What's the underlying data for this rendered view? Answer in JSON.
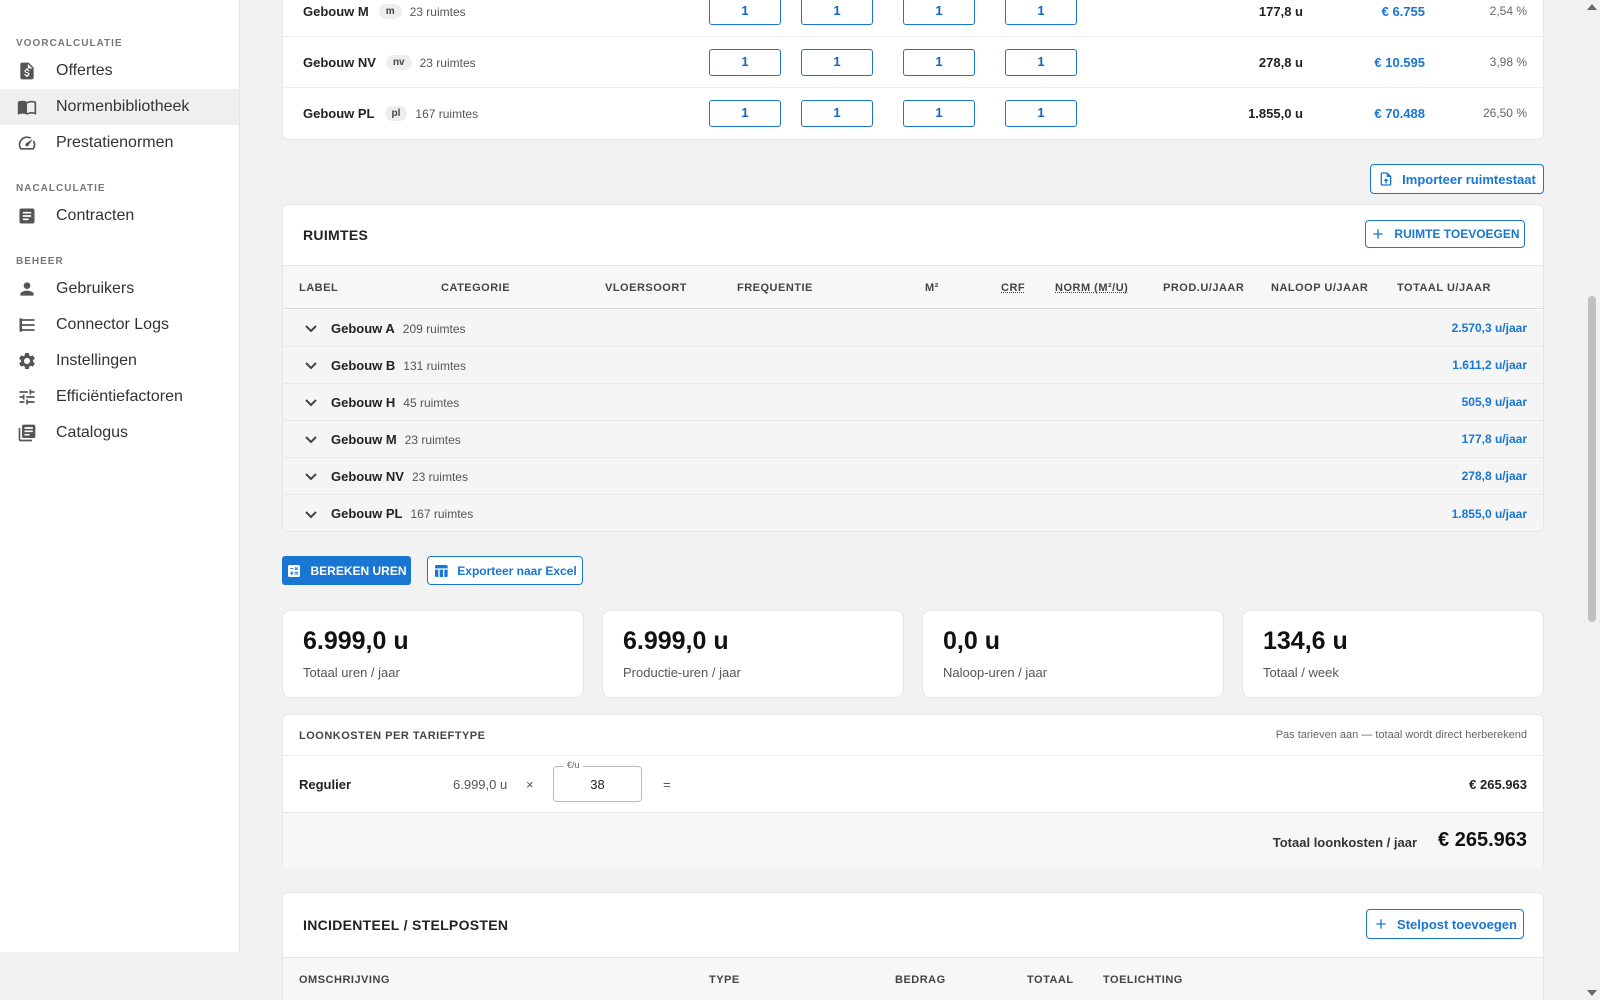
{
  "sidebar": {
    "sections": [
      {
        "title": "VOORCALCULATIE",
        "items": [
          {
            "label": "Offertes",
            "icon": "invoice-icon"
          },
          {
            "label": "Normenbibliotheek",
            "icon": "book-icon"
          },
          {
            "label": "Prestatienormen",
            "icon": "speedometer-icon"
          }
        ]
      },
      {
        "title": "NACALCULATIE",
        "items": [
          {
            "label": "Contracten",
            "icon": "document-icon"
          }
        ]
      },
      {
        "title": "BEHEER",
        "items": [
          {
            "label": "Gebruikers",
            "icon": "person-icon"
          },
          {
            "label": "Connector Logs",
            "icon": "list-icon"
          },
          {
            "label": "Instellingen",
            "icon": "gear-icon"
          },
          {
            "label": "Efficiëntiefactoren",
            "icon": "sliders-icon"
          },
          {
            "label": "Catalogus",
            "icon": "library-icon"
          }
        ]
      }
    ]
  },
  "buildings": [
    {
      "name": "Gebouw M",
      "code": "m",
      "rooms": "23 ruimtes",
      "inputs": [
        "1",
        "1",
        "1",
        "1"
      ],
      "hours": "177,8 u",
      "cost": "€ 6.755",
      "pct": "2,54 %"
    },
    {
      "name": "Gebouw NV",
      "code": "nv",
      "rooms": "23 ruimtes",
      "inputs": [
        "1",
        "1",
        "1",
        "1"
      ],
      "hours": "278,8 u",
      "cost": "€ 10.595",
      "pct": "3,98 %"
    },
    {
      "name": "Gebouw PL",
      "code": "pl",
      "rooms": "167 ruimtes",
      "inputs": [
        "1",
        "1",
        "1",
        "1"
      ],
      "hours": "1.855,0 u",
      "cost": "€ 70.488",
      "pct": "26,50 %"
    }
  ],
  "import_button": "Importeer ruimtestaat",
  "ruimtes": {
    "title": "RUIMTES",
    "add_button": "RUIMTE TOEVOEGEN",
    "columns": [
      "LABEL",
      "CATEGORIE",
      "VLOERSOORT",
      "FREQUENTIE",
      "M²",
      "CRF",
      "NORM (M²/U)",
      "PROD.U/JAAR",
      "NALOOP U/JAAR",
      "TOTAAL U/JAAR"
    ],
    "groups": [
      {
        "name": "Gebouw A",
        "rooms": "209 ruimtes",
        "total": "2.570,3 u/jaar"
      },
      {
        "name": "Gebouw B",
        "rooms": "131 ruimtes",
        "total": "1.611,2 u/jaar"
      },
      {
        "name": "Gebouw H",
        "rooms": "45 ruimtes",
        "total": "505,9 u/jaar"
      },
      {
        "name": "Gebouw M",
        "rooms": "23 ruimtes",
        "total": "177,8 u/jaar"
      },
      {
        "name": "Gebouw NV",
        "rooms": "23 ruimtes",
        "total": "278,8 u/jaar"
      },
      {
        "name": "Gebouw PL",
        "rooms": "167 ruimtes",
        "total": "1.855,0 u/jaar"
      }
    ]
  },
  "actions": {
    "calculate": "BEREKEN UREN",
    "export": "Exporteer naar Excel"
  },
  "stats": [
    {
      "value": "6.999,0 u",
      "label": "Totaal uren / jaar"
    },
    {
      "value": "6.999,0 u",
      "label": "Productie-uren / jaar"
    },
    {
      "value": "0,0 u",
      "label": "Naloop-uren / jaar"
    },
    {
      "value": "134,6 u",
      "label": "Totaal / week"
    }
  ],
  "loonkosten": {
    "title": "LOONKOSTEN PER TARIEFTYPE",
    "hint": "Pas tarieven aan — totaal wordt direct herberekend",
    "row": {
      "label": "Regulier",
      "hours": "6.999,0 u",
      "times": "×",
      "rate_label": "€/u",
      "rate": "38",
      "equals": "=",
      "total": "€ 265.963"
    },
    "total_label": "Totaal loonkosten / jaar",
    "total_value": "€ 265.963"
  },
  "incidenteel": {
    "title": "INCIDENTEEL / STELPOSTEN",
    "add_button": "Stelpost toevoegen",
    "columns": [
      "OMSCHRIJVING",
      "TYPE",
      "BEDRAG",
      "TOTAAL",
      "TOELICHTING"
    ]
  }
}
